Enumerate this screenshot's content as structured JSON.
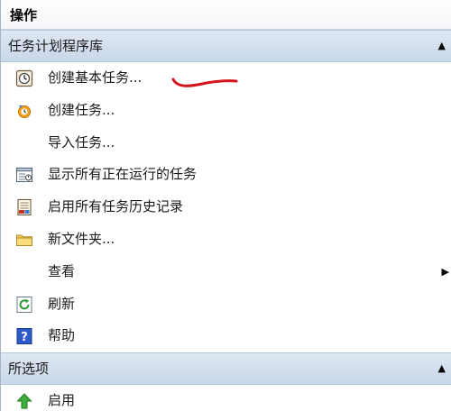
{
  "pane": {
    "title": "操作"
  },
  "section_task_library": {
    "header": "任务计划程序库",
    "collapse_glyph": "▲",
    "items": [
      {
        "label": "创建基本任务...",
        "icon": "create-basic-task-icon"
      },
      {
        "label": "创建任务...",
        "icon": "create-task-icon"
      },
      {
        "label": "导入任务...",
        "icon": ""
      },
      {
        "label": "显示所有正在运行的任务",
        "icon": "running-tasks-icon"
      },
      {
        "label": "启用所有任务历史记录",
        "icon": "task-history-icon"
      },
      {
        "label": "新文件夹...",
        "icon": "folder-icon"
      },
      {
        "label": "查看",
        "icon": "",
        "submenu_glyph": "▶"
      },
      {
        "label": "刷新",
        "icon": "refresh-icon"
      },
      {
        "label": "帮助",
        "icon": "help-icon"
      }
    ]
  },
  "section_selected": {
    "header": "所选项",
    "collapse_glyph": "▲",
    "items": [
      {
        "label": "启用",
        "icon": "enable-arrow-icon"
      }
    ]
  },
  "colors": {
    "section_header_bg": "#c8d7ea",
    "annotation_red": "#d4141c"
  }
}
